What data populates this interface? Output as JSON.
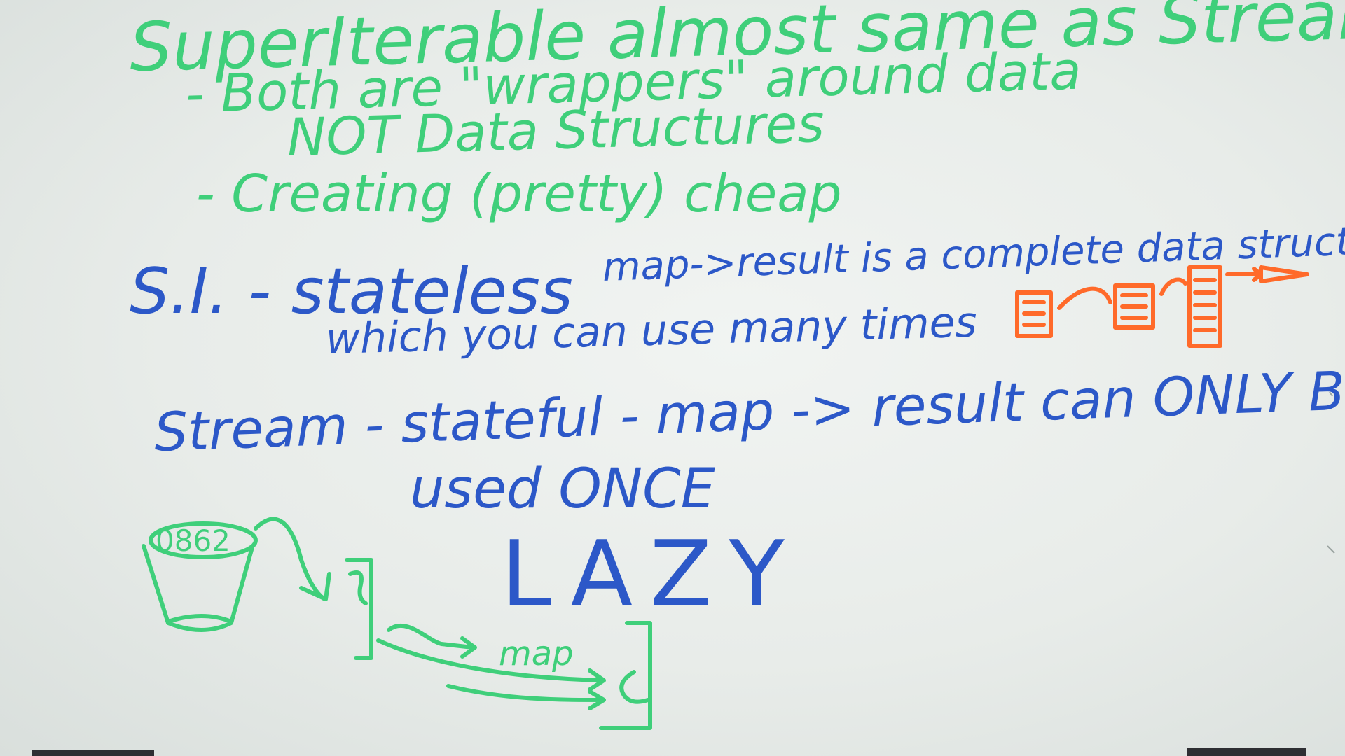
{
  "board": {
    "line1": "SuperIterable almost same as Stream",
    "line2": "- Both are \"wrappers\" around data",
    "line3": "NOT Data Structures",
    "line4": "- Creating (pretty) cheap",
    "si_label": "S.I. - stateless",
    "si_desc": "map->result is a complete data structure",
    "si_desc2": "which you can use many times",
    "stream_label": "Stream - stateful - map -> result can ONLY BE",
    "stream_desc": "used ONCE",
    "lazy": "LAZY",
    "diagram_map": "map",
    "bucket_text": "0862"
  },
  "colors": {
    "board_bg": "#eef1ef",
    "green_marker": "#3fcf7a",
    "blue_marker": "#2c58c8",
    "orange_marker": "#ff6a2a"
  }
}
